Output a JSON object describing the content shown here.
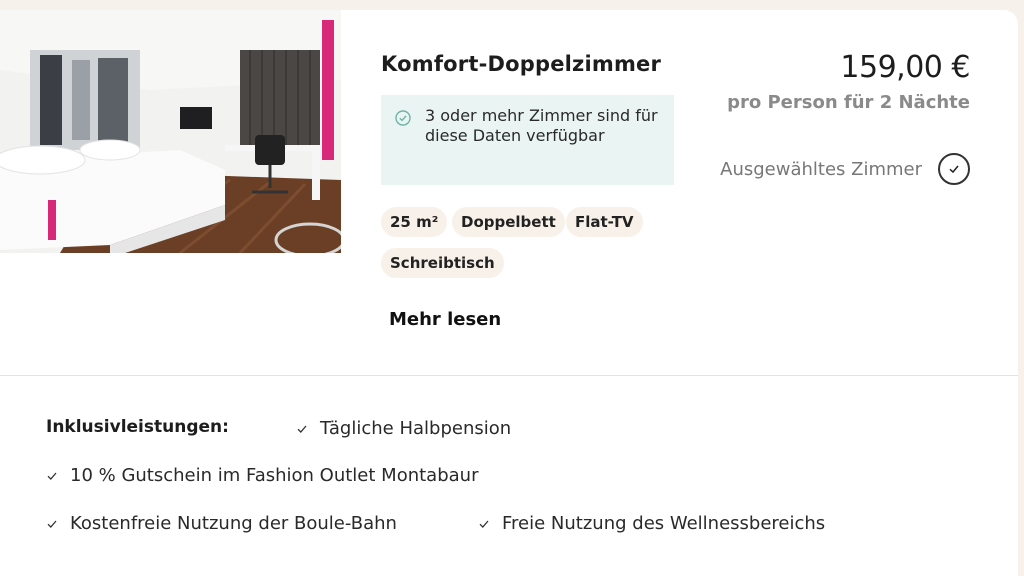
{
  "room": {
    "title": "Komfort-Doppelzimmer",
    "availability": "3 oder mehr Zimmer sind für diese Daten verfügbar",
    "tags": [
      "25 m²",
      "Doppelbett",
      "Flat-TV",
      "Schreibtisch"
    ],
    "more_link": "Mehr lesen",
    "photo_icon": "hotel-room-photo"
  },
  "pricing": {
    "price": "159,00 €",
    "price_note": "pro Person für 2 Nächte",
    "selected_label": "Ausgewähltes Zimmer",
    "selected_icon": "check-circle-icon"
  },
  "inclusions": {
    "heading": "Inklusivleistungen:",
    "items": [
      "Tägliche Halbpension",
      "10 % Gutschein im Fashion Outlet Montabaur",
      "Kostenfreie Nutzung der Boule-Bahn",
      "Freie Nutzung des Wellnessbereichs"
    ]
  },
  "colors": {
    "availability_bg": "#eaf4f3",
    "availability_icon": "#6fb3a6",
    "tag_bg": "#f8f1ea",
    "muted_text": "#8a8a8a"
  }
}
